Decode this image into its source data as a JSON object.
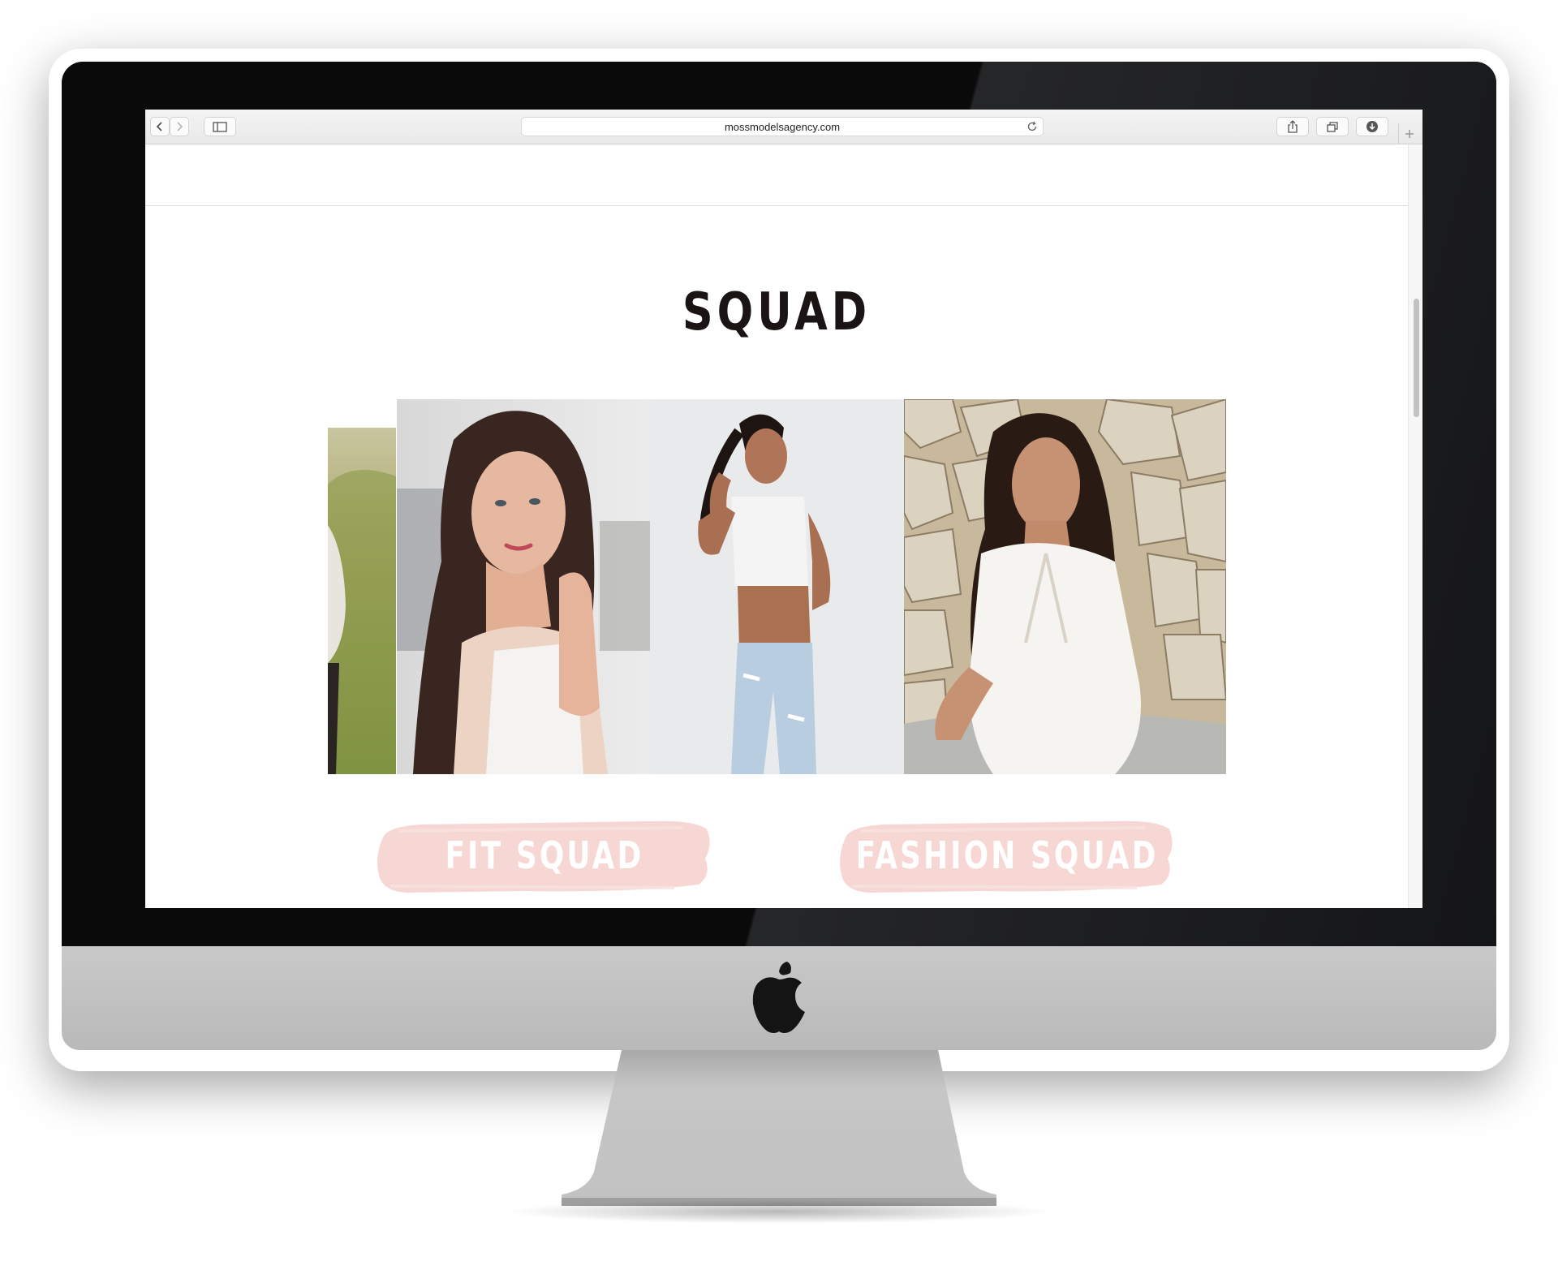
{
  "browser": {
    "url": "mossmodelsagency.com"
  },
  "section": {
    "title": "SQUAD"
  },
  "buttons": {
    "fit": "FIT SQUAD",
    "fashion": "FASHION SQUAD"
  },
  "colors": {
    "brush_pink": "#f6d7d4",
    "title": "#1a1414"
  },
  "icons": [
    "back-arrow-icon",
    "forward-arrow-icon",
    "sidebar-icon",
    "reload-icon",
    "share-icon",
    "tabs-icon",
    "download-icon",
    "plus-icon",
    "apple-logo-icon"
  ]
}
